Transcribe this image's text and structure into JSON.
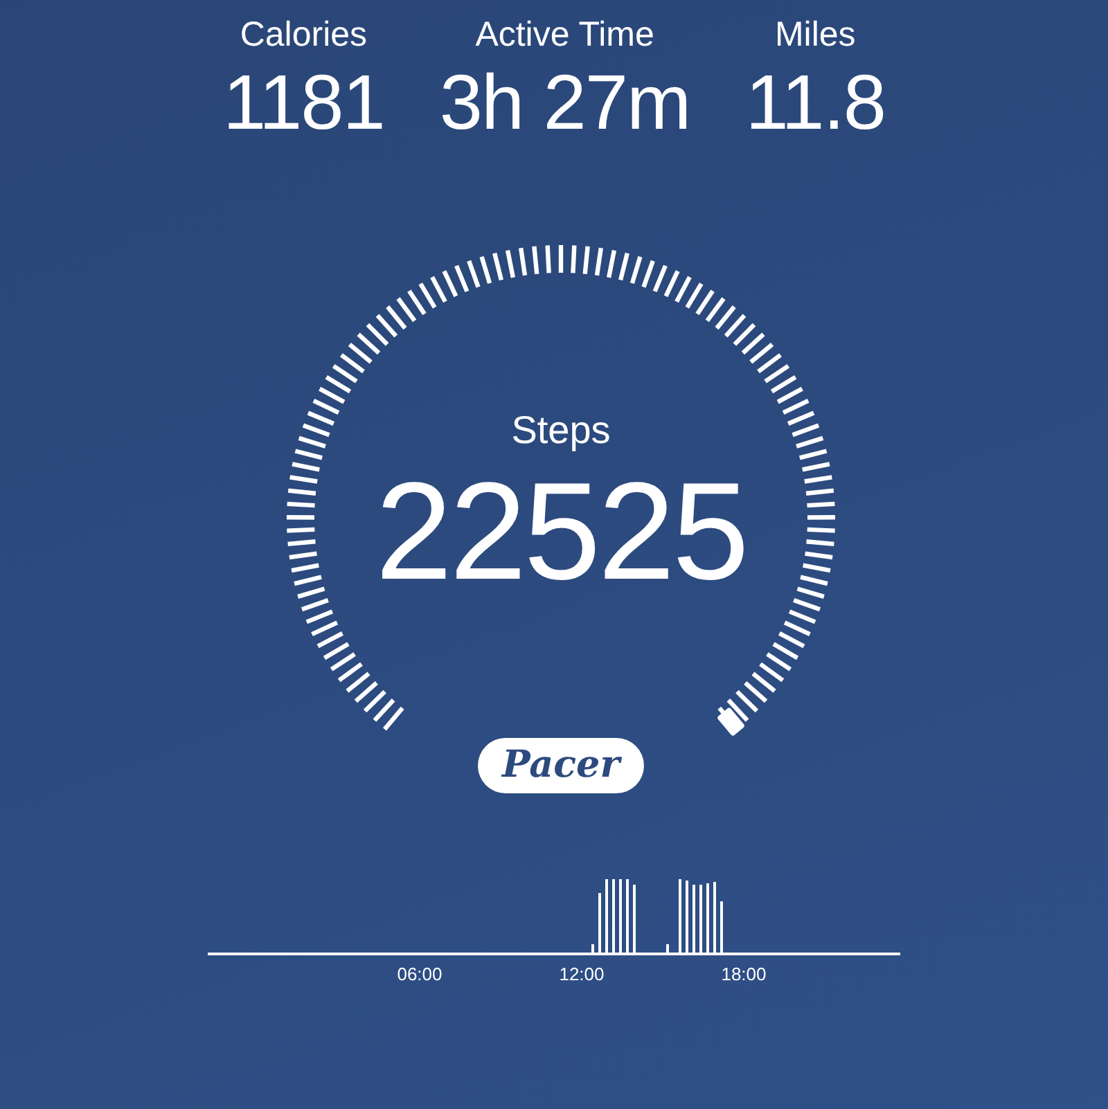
{
  "stats": [
    {
      "label": "Calories",
      "value": "1181"
    },
    {
      "label": "Active Time",
      "value": "3h 27m"
    },
    {
      "label": "Miles",
      "value": "11.8"
    }
  ],
  "gauge": {
    "label": "Steps",
    "value": "22525"
  },
  "brand": "Pacer",
  "activity_chart": {
    "ticks": [
      "06:00",
      "12:00",
      "18:00"
    ]
  }
}
